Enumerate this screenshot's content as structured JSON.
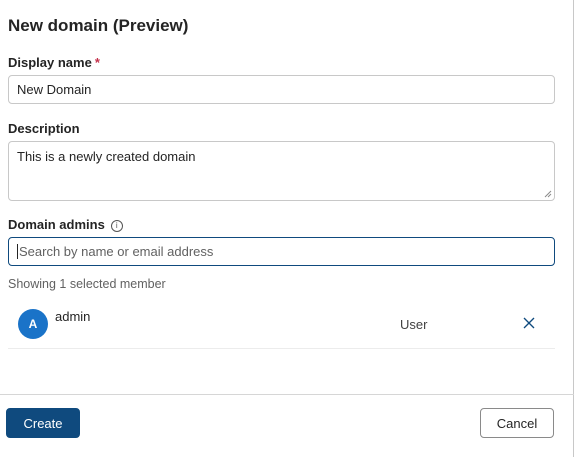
{
  "dialog": {
    "title": "New domain (Preview)"
  },
  "display_name": {
    "label": "Display name",
    "required_marker": "*",
    "value": "New Domain"
  },
  "description": {
    "label": "Description",
    "value": "This is a newly created domain"
  },
  "domain_admins": {
    "label": "Domain admins",
    "info_icon": "info-icon",
    "search_placeholder": "Search by name or email address",
    "selected_summary": "Showing 1 selected member",
    "members": [
      {
        "avatar_initial": "A",
        "name": "admin",
        "role": "User",
        "remove_icon": "close-icon"
      }
    ]
  },
  "footer": {
    "create_label": "Create",
    "cancel_label": "Cancel"
  },
  "colors": {
    "primary": "#0f4a7e",
    "avatar": "#1a73c8",
    "required": "#c4314b"
  }
}
